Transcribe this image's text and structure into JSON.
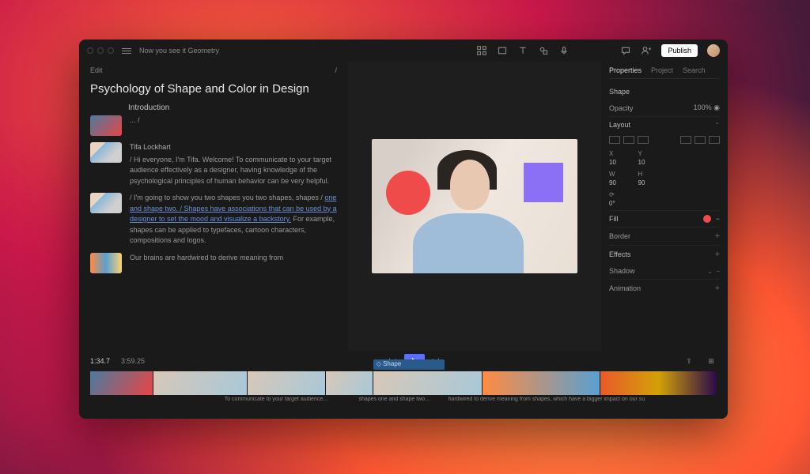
{
  "titlebar": {
    "title": "Now you see it Geometry",
    "publish": "Publish"
  },
  "left": {
    "edit": "Edit",
    "slash": "/",
    "doc_title": "Psychology of Shape and Color in Design",
    "section": "Introduction",
    "ellipsis": "... /",
    "speaker": "Tifa Lockhart",
    "p1": "/ Hi everyone, I'm Tifa. Welcome! To communicate to your target audience effectively as a designer, having knowledge of the psychological principles of human behavior can be very helpful.",
    "p2a": "/ I'm going to show you two shapes you two shapes, shapes / ",
    "p2link": "one and shape two. / Shapes have associations that can be used by a designer to set the mood and visualize a backstory.",
    "p2b": " For example, shapes can be applied to typefaces, cartoon characters, compositions and logos.",
    "p3": "Our brains are hardwired to derive meaning from"
  },
  "props": {
    "tabs": {
      "properties": "Properties",
      "project": "Project",
      "search": "Search"
    },
    "shape": "Shape",
    "opacity_l": "Opacity",
    "opacity_v": "100%",
    "layout": "Layout",
    "x_l": "X",
    "x_v": "10",
    "y_l": "Y",
    "y_v": "10",
    "w_l": "W",
    "w_v": "90",
    "h_l": "H",
    "h_v": "90",
    "r_l": "⟳",
    "r_v": "0°",
    "fill": "Fill",
    "border": "Border",
    "effects": "Effects",
    "shadow": "Shadow",
    "animation": "Animation"
  },
  "transport": {
    "current": "1:34.7",
    "total": "3:59.25"
  },
  "timeline": {
    "shape_label": "◇ Shape",
    "cap1": "To communicate to your target audience…",
    "cap2": "shapes one and shape two…",
    "cap3": "hardwired to derive meaning from shapes, which have a bigger impact on our su"
  }
}
